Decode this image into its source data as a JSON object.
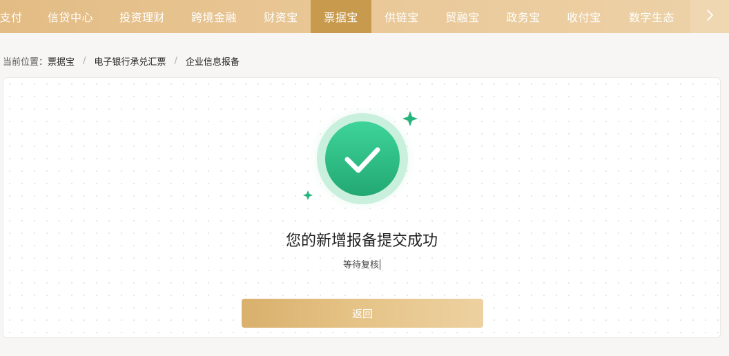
{
  "nav": {
    "items": [
      {
        "label": "支付"
      },
      {
        "label": "信贷中心"
      },
      {
        "label": "投资理财"
      },
      {
        "label": "跨境金融"
      },
      {
        "label": "财资宝"
      },
      {
        "label": "票据宝",
        "active": true
      },
      {
        "label": "供链宝"
      },
      {
        "label": "贸融宝"
      },
      {
        "label": "政务宝"
      },
      {
        "label": "收付宝"
      },
      {
        "label": "数字生态"
      }
    ],
    "more_icon": "chevron-right-icon"
  },
  "breadcrumb": {
    "prefix": "当前位置：",
    "items": [
      "票据宝",
      "电子银行承兑汇票",
      "企业信息报备"
    ],
    "separator": "/"
  },
  "result": {
    "icon": "check-circle-icon",
    "title": "您的新增报备提交成功",
    "subtitle": "等待复核",
    "button_label": "返回"
  },
  "colors": {
    "nav_bg": "#e6c28e",
    "nav_active": "#c79a4e",
    "success_green": "#34c08a",
    "button_gold": "#e2bd7d"
  }
}
